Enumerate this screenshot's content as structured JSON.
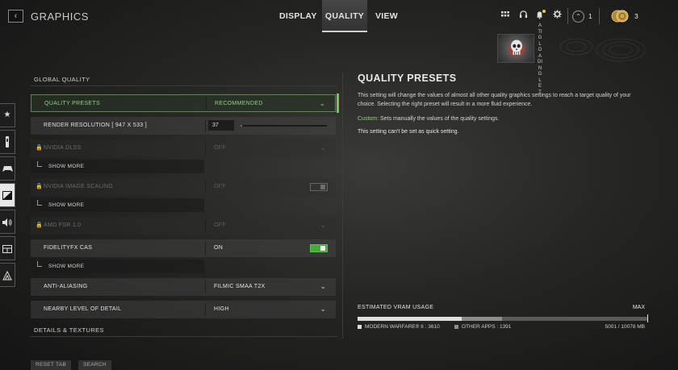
{
  "header": {
    "back_icon": "chevron-left-icon",
    "title": "GRAPHICS",
    "tabs": [
      {
        "label": "DISPLAY",
        "active": false
      },
      {
        "label": "QUALITY",
        "active": true
      },
      {
        "label": "VIEW",
        "active": false
      }
    ],
    "icons": [
      "grid-icon",
      "headset-icon",
      "bell-icon",
      "gear-icon"
    ],
    "rank_count": "1",
    "currency_count": "3",
    "player_name_vertical": "ATI GLOADINGLET",
    "notification_color": "#f2c94c"
  },
  "sidebar": {
    "items": [
      {
        "icon": "star-icon",
        "glyph": "★",
        "active": false
      },
      {
        "icon": "gun-icon",
        "glyph": "⚿",
        "active": false
      },
      {
        "icon": "controller-icon",
        "glyph": "⊕",
        "active": false
      },
      {
        "icon": "graphics-icon",
        "glyph": "▨",
        "active": true
      },
      {
        "icon": "speaker-icon",
        "glyph": "🔊",
        "active": false
      },
      {
        "icon": "interface-icon",
        "glyph": "⊟",
        "active": false
      },
      {
        "icon": "network-icon",
        "glyph": "⊛",
        "active": false
      }
    ]
  },
  "settings": {
    "section_global": "GLOBAL QUALITY",
    "quality_presets": {
      "label": "QUALITY PRESETS",
      "value": "RECOMMENDED"
    },
    "render_resolution": {
      "label": "RENDER RESOLUTION [ 947 X 533 ]",
      "value": "37",
      "fraction": 0.02
    },
    "nvidia_dlss": {
      "label": "NVIDIA DLSS",
      "value": "OFF"
    },
    "show_more_1": "SHOW MORE",
    "nvidia_image_scaling": {
      "label": "NVIDIA IMAGE SCALING",
      "value": "OFF"
    },
    "show_more_2": "SHOW MORE",
    "amd_fsr": {
      "label": "AMD FSR 1.0",
      "value": "OFF"
    },
    "fidelityfx_cas": {
      "label": "FIDELITYFX CAS",
      "value": "ON"
    },
    "show_more_3": "SHOW MORE",
    "anti_aliasing": {
      "label": "ANTI-ALIASING",
      "value": "FILMIC SMAA T2X"
    },
    "nearby_lod": {
      "label": "NEARBY LEVEL OF DETAIL",
      "value": "HIGH"
    },
    "section_details": "DETAILS & TEXTURES"
  },
  "bottom_buttons": {
    "reset_tab": "RESET TAB",
    "search": "SEARCH"
  },
  "info": {
    "title": "QUALITY PRESETS",
    "description": "This setting will change the values of almost all other quality graphics settings to reach a target quality of your choice. Selecting the right preset will result in a more fluid experience.",
    "custom_label": "Custom:",
    "custom_text": " Sets manually the values of the quality settings.",
    "note": "This setting can't be set as quick setting."
  },
  "vram": {
    "title": "ESTIMATED VRAM USAGE",
    "max_label": "MAX",
    "game_label": "MODERN WARFARE® II : 3610",
    "other_label": "OTHER APPS : 1391",
    "total_label": "5001 / 10078 MB",
    "game_mb": 3610,
    "other_mb": 1391,
    "max_mb": 10078
  },
  "colors": {
    "accent_green": "#8fd27f",
    "toggle_on": "#46a83d"
  }
}
